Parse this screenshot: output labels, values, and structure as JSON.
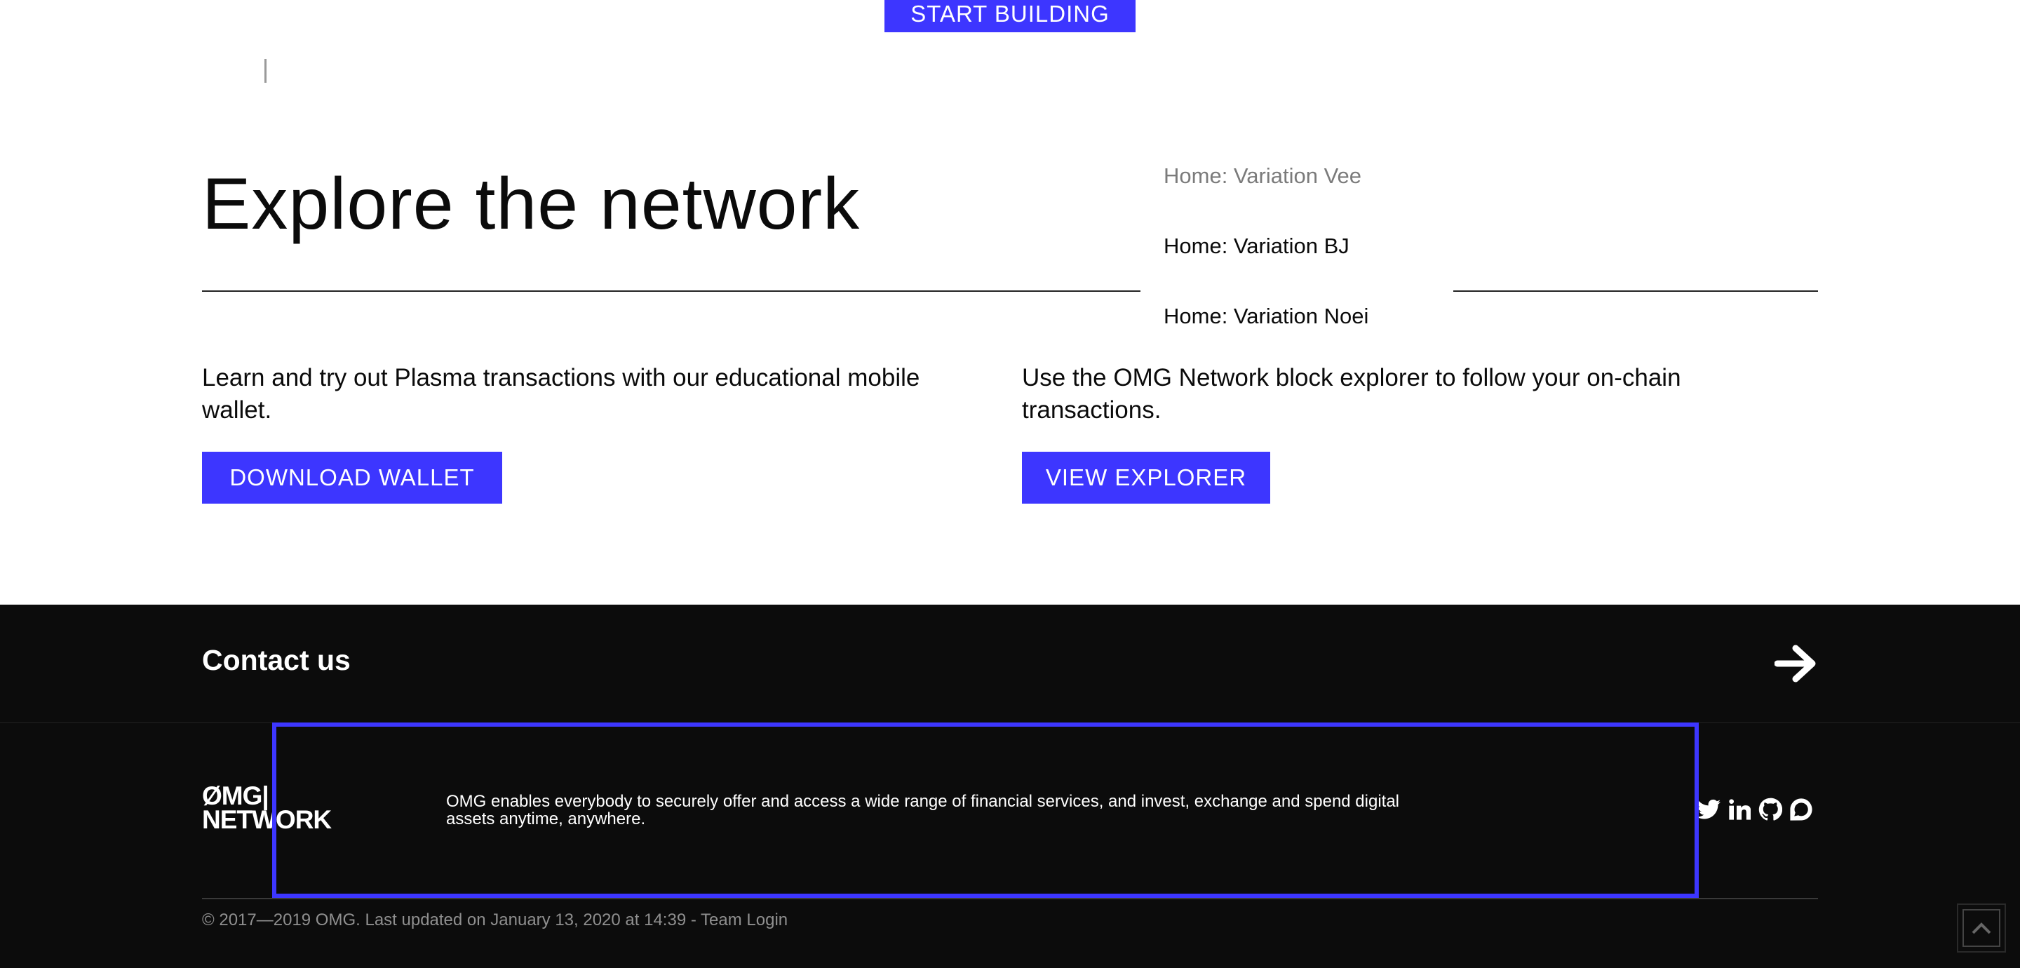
{
  "top": {
    "start_building_label": "START BUILDING"
  },
  "hero": {
    "title": "Explore the network"
  },
  "dropdown": {
    "items": [
      {
        "label": "Home: Variation Vee"
      },
      {
        "label": "Home: Variation BJ"
      },
      {
        "label": "Home: Variation Noei"
      }
    ]
  },
  "wallet": {
    "text": "Learn and try out Plasma transactions with our educational mobile wallet.",
    "button_label": "DOWNLOAD WALLET"
  },
  "explorer": {
    "text": "Use the OMG Network block explorer to follow your on-chain transactions.",
    "button_label": "VIEW EXPLORER"
  },
  "footer": {
    "contact_label": "Contact us",
    "logo_line1": "ØMG|",
    "logo_line2": "NETWORK",
    "tagline": "OMG enables everybody to securely offer and access a wide range of financial services, and invest, exchange and spend digital assets anytime, anywhere.",
    "copyright": "© 2017—2019 OMG. Last updated on January 13, 2020 at 14:39 - Team Login",
    "socials": [
      "twitter-icon",
      "linkedin-icon",
      "github-icon",
      "discourse-icon"
    ]
  },
  "colors": {
    "accent": "#3d36ff",
    "footer_bg": "#0c0c0c",
    "text": "#0b0b0b",
    "muted": "#7b7b7b"
  }
}
